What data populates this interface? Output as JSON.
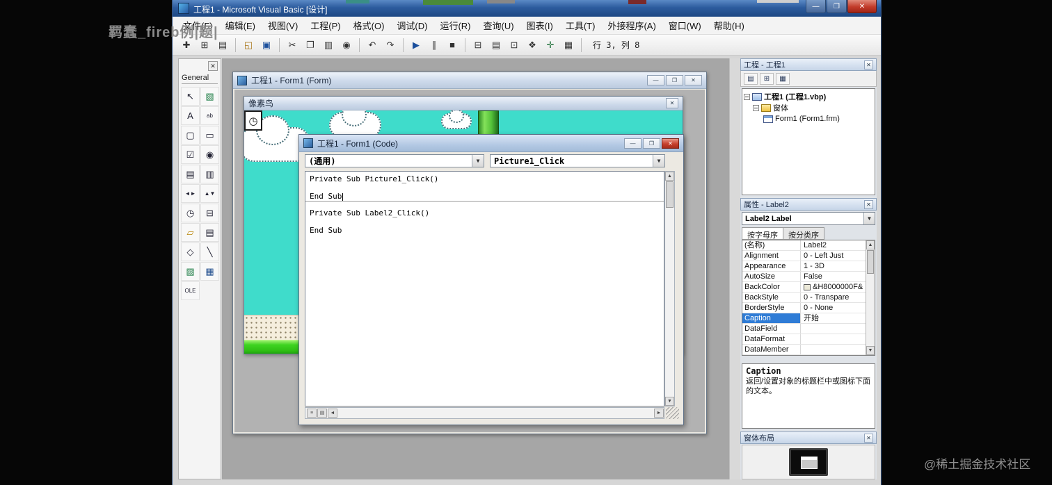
{
  "watermarks": {
    "top_left": "羁蠢_fireb例|题|",
    "bottom_right": "@稀土掘金技术社区"
  },
  "titlebar": {
    "title": "工程1 - Microsoft Visual Basic [设计]",
    "minimize": "—",
    "maximize": "❐",
    "close": "✕"
  },
  "menu": [
    "文件(F)",
    "编辑(E)",
    "视图(V)",
    "工程(P)",
    "格式(O)",
    "调试(D)",
    "运行(R)",
    "查询(U)",
    "图表(I)",
    "工具(T)",
    "外接程序(A)",
    "窗口(W)",
    "帮助(H)"
  ],
  "toolbar": {
    "buttons": [
      {
        "id": "add-project",
        "glyph": "✚"
      },
      {
        "id": "add-form",
        "glyph": "⊞"
      },
      {
        "id": "menu-editor",
        "glyph": "▤"
      },
      {
        "id": "open-project",
        "glyph": "◱"
      },
      {
        "id": "save-project",
        "glyph": "▣"
      },
      {
        "id": "cut",
        "glyph": "✂"
      },
      {
        "id": "copy",
        "glyph": "❐"
      },
      {
        "id": "paste",
        "glyph": "▥"
      },
      {
        "id": "find",
        "glyph": "◉"
      },
      {
        "id": "undo",
        "glyph": "↶"
      },
      {
        "id": "redo",
        "glyph": "↷"
      },
      {
        "id": "start",
        "glyph": "▶"
      },
      {
        "id": "break",
        "glyph": "∥"
      },
      {
        "id": "end",
        "glyph": "■"
      },
      {
        "id": "project-explorer",
        "glyph": "⊟"
      },
      {
        "id": "properties-window",
        "glyph": "▤"
      },
      {
        "id": "form-layout",
        "glyph": "⊡"
      },
      {
        "id": "object-browser",
        "glyph": "❖"
      },
      {
        "id": "toolbox",
        "glyph": "✛"
      },
      {
        "id": "data-view",
        "glyph": "▦"
      }
    ],
    "position_indicator": "行 3, 列 8"
  },
  "toolbox": {
    "tab": "General",
    "tools": [
      {
        "id": "pointer",
        "glyph": "↖"
      },
      {
        "id": "picturebox",
        "glyph": "▧"
      },
      {
        "id": "label",
        "glyph": "A"
      },
      {
        "id": "textbox",
        "glyph": "ab"
      },
      {
        "id": "frame",
        "glyph": "▢"
      },
      {
        "id": "commandbutton",
        "glyph": "▭"
      },
      {
        "id": "checkbox",
        "glyph": "☑"
      },
      {
        "id": "optionbutton",
        "glyph": "◉"
      },
      {
        "id": "combobox",
        "glyph": "▤"
      },
      {
        "id": "listbox",
        "glyph": "▥"
      },
      {
        "id": "hscrollbar",
        "glyph": "◄►"
      },
      {
        "id": "vscrollbar",
        "glyph": "▲▼"
      },
      {
        "id": "timer",
        "glyph": "◷"
      },
      {
        "id": "drivelistbox",
        "glyph": "⊟"
      },
      {
        "id": "dirlistbox",
        "glyph": "▱"
      },
      {
        "id": "filelistbox",
        "glyph": "▤"
      },
      {
        "id": "shape",
        "glyph": "◇"
      },
      {
        "id": "line",
        "glyph": "╲"
      },
      {
        "id": "image",
        "glyph": "▨"
      },
      {
        "id": "data",
        "glyph": "▦"
      },
      {
        "id": "ole",
        "glyph": "OLE"
      }
    ]
  },
  "designer": {
    "title": "工程1 - Form1 (Form)"
  },
  "game_form": {
    "title": "像素鸟"
  },
  "code_window": {
    "title": "工程1 - Form1 (Code)",
    "object_combo": "(通用)",
    "procedure_combo": "Picture1_Click",
    "lines": [
      "Private Sub Picture1_Click()",
      "",
      "End Sub",
      "",
      "Private Sub Label2_Click()",
      "",
      "End Sub"
    ]
  },
  "project_explorer": {
    "title": "工程 - 工程1",
    "buttons": [
      {
        "id": "view-code",
        "glyph": "▤"
      },
      {
        "id": "view-object",
        "glyph": "⊞"
      },
      {
        "id": "toggle-folders",
        "glyph": "▦"
      }
    ],
    "nodes": [
      {
        "label": "工程1 (工程1.vbp)"
      },
      {
        "label": "窗体"
      },
      {
        "label": "Form1 (Form1.frm)"
      }
    ]
  },
  "properties": {
    "title": "属性 - Label2",
    "object_selector": "Label2 Label",
    "tabs": [
      "按字母序",
      "按分类序"
    ],
    "rows": [
      {
        "name": "(名称)",
        "value": "Label2"
      },
      {
        "name": "Alignment",
        "value": "0 - Left Just"
      },
      {
        "name": "Appearance",
        "value": "1 - 3D"
      },
      {
        "name": "AutoSize",
        "value": "False"
      },
      {
        "name": "BackColor",
        "value": "&H8000000F&"
      },
      {
        "name": "BackStyle",
        "value": "0 - Transpare"
      },
      {
        "name": "BorderStyle",
        "value": "0 - None"
      },
      {
        "name": "Caption",
        "value": "开始"
      },
      {
        "name": "DataField",
        "value": ""
      },
      {
        "name": "DataFormat",
        "value": ""
      },
      {
        "name": "DataMember",
        "value": ""
      }
    ],
    "selected_row": "Caption",
    "description_title": "Caption",
    "description": "返回/设置对象的标题栏中或图标下面的文本。"
  },
  "form_layout": {
    "title": "窗体布局"
  },
  "colors": {
    "titlebar": "#2d5c9e",
    "mdi_background": "#a6a6a6",
    "game_background": "#3fdccb",
    "grass": "#3ed321",
    "pipe": "#55c23a",
    "selection": "#2f7cd6",
    "close_button": "#c7402e"
  }
}
